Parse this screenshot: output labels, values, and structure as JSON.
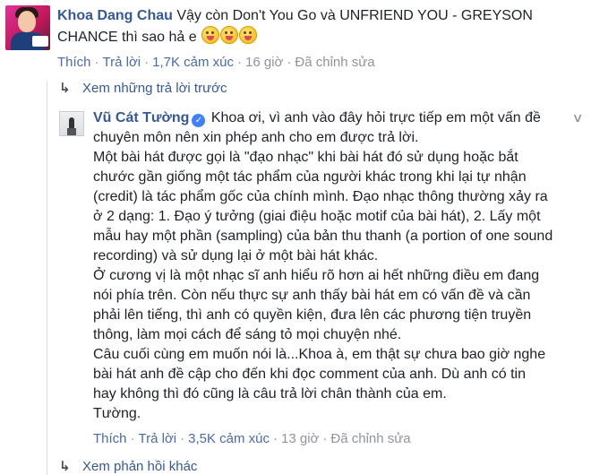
{
  "top_comment": {
    "author": "Khoa Dang Chau",
    "text": "Vậy còn Don't You Go và UNFRIEND YOU - GREYSON CHANCE thì sao hả e",
    "emoji_count": 3,
    "meta": {
      "like": "Thích",
      "reply": "Trả lời",
      "reactions": "1,7K cảm xúc",
      "time": "16 giờ",
      "edited": "Đã chỉnh sửa"
    }
  },
  "view_previous": "Xem những trả lời trước",
  "reply": {
    "author": "Vũ Cát Tường",
    "verified": true,
    "lines": [
      "Khoa ơi, vì anh vào đây hỏi trực tiếp em một vấn đề",
      "chuyên môn nên xin phép anh cho em được trả lời.",
      "Một bài hát được gọi là \"đạo nhạc\" khi bài hát đó sử dụng hoặc bắt",
      "chước gần giống một tác phẩm của người khác trong khi lại tự nhận",
      "(credit) là tác phẩm gốc của chính mình. Đạo nhạc thông thường xảy ra",
      "ở 2 dạng: 1. Đạo ý tưởng (giai điệu hoặc motif của bài hát), 2. Lấy một",
      "mẫu hay một phần (sampling) của bản thu thanh (a portion of one sound",
      "recording) và sử dụng lại ở một bài hát khác.",
      "Ở cương vị là một nhạc sĩ anh hiểu rõ hơn ai hết những điều em đang",
      "nói phía trên. Còn nếu thực sự anh thấy bài hát em có vấn đề và cần",
      "phải lên tiếng, thì anh có quyền kiện, đưa lên các phương tiện truyền",
      "thông, làm mọi cách để sáng tỏ mọi chuyện nhé.",
      "Câu cuối cùng em muốn nói là...Khoa à, em thật sự chưa bao giờ nghe",
      "bài hát anh đề cập cho đến khi đọc comment của anh. Dù anh có tin",
      "hay không thì đó cũng là câu trả lời chân thành của em.",
      "Tường."
    ],
    "meta": {
      "like": "Thích",
      "reply": "Trả lời",
      "reactions": "3,5K cảm xúc",
      "time": "13 giờ",
      "edited": "Đã chỉnh sửa"
    }
  },
  "view_more": "Xem phản hồi khác",
  "colors": {
    "link": "#365899",
    "meta": "#90949c",
    "verified": "#4080ff"
  }
}
